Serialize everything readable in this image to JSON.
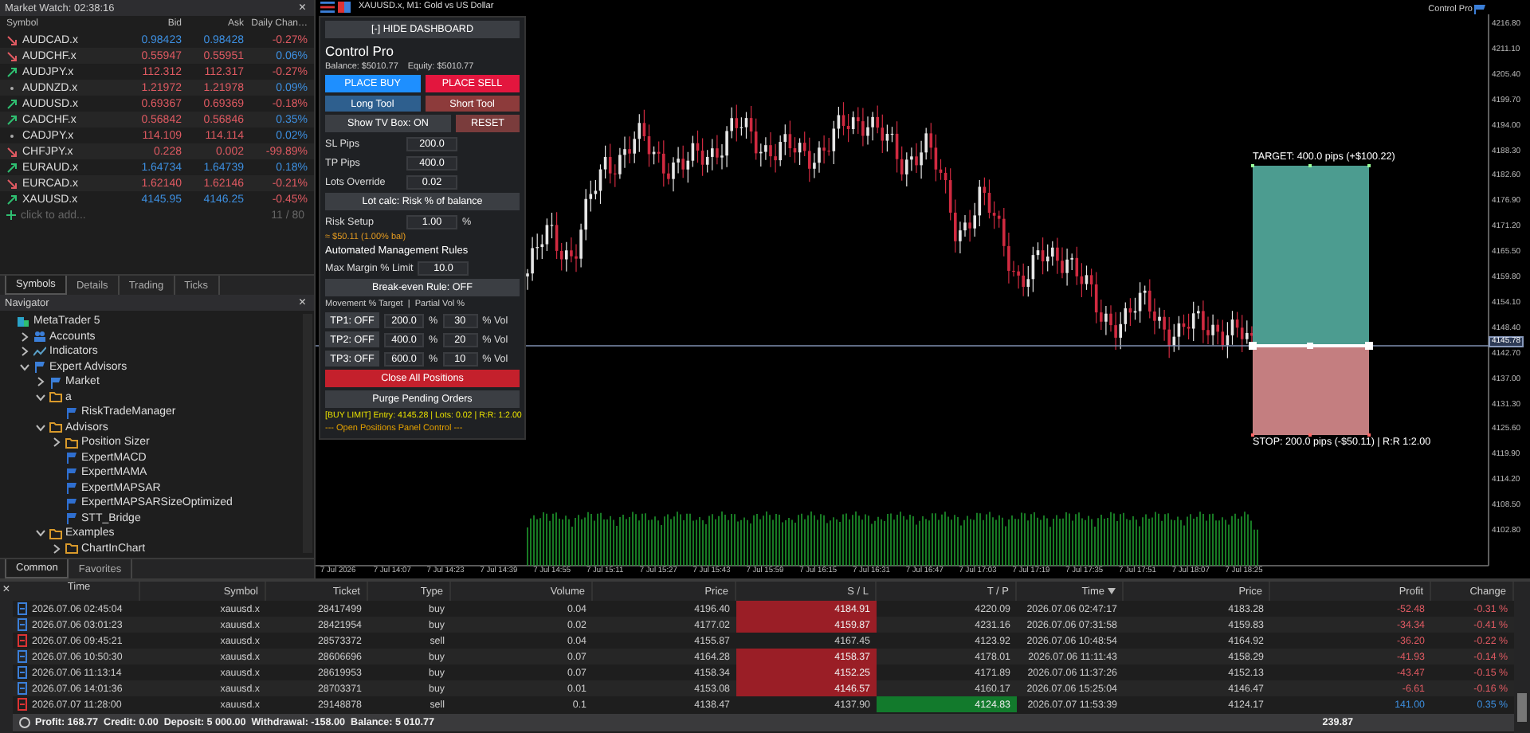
{
  "market_watch": {
    "title": "Market Watch: 02:38:16",
    "close": "×",
    "columns": [
      "Symbol",
      "Bid",
      "Ask",
      "Daily Chan…"
    ],
    "rows": [
      {
        "kind": "down",
        "symbol": "AUDCAD.x",
        "bid": "0.98423",
        "ask": "0.98428",
        "rising": true,
        "change": "-0.27%",
        "change_up": false
      },
      {
        "kind": "down",
        "symbol": "AUDCHF.x",
        "bid": "0.55947",
        "ask": "0.55951",
        "rising": false,
        "change": "0.06%",
        "change_up": true
      },
      {
        "kind": "up",
        "symbol": "AUDJPY.x",
        "bid": "112.312",
        "ask": "112.317",
        "rising": false,
        "change": "-0.27%",
        "change_up": false
      },
      {
        "kind": "flat",
        "symbol": "AUDNZD.x",
        "bid": "1.21972",
        "ask": "1.21978",
        "rising": false,
        "change": "0.09%",
        "change_up": true
      },
      {
        "kind": "up",
        "symbol": "AUDUSD.x",
        "bid": "0.69367",
        "ask": "0.69369",
        "rising": false,
        "change": "-0.18%",
        "change_up": false
      },
      {
        "kind": "up",
        "symbol": "CADCHF.x",
        "bid": "0.56842",
        "ask": "0.56846",
        "rising": false,
        "change": "0.35%",
        "change_up": true
      },
      {
        "kind": "flat",
        "symbol": "CADJPY.x",
        "bid": "114.109",
        "ask": "114.114",
        "rising": false,
        "change": "0.02%",
        "change_up": true
      },
      {
        "kind": "down",
        "symbol": "CHFJPY.x",
        "bid": "0.228",
        "ask": "0.002",
        "rising": false,
        "change": "-99.89%",
        "change_up": false
      },
      {
        "kind": "up",
        "symbol": "EURAUD.x",
        "bid": "1.64734",
        "ask": "1.64739",
        "rising": true,
        "change": "0.18%",
        "change_up": true
      },
      {
        "kind": "down",
        "symbol": "EURCAD.x",
        "bid": "1.62140",
        "ask": "1.62146",
        "rising": false,
        "change": "-0.21%",
        "change_up": false
      },
      {
        "kind": "up",
        "symbol": "XAUUSD.x",
        "bid": "4145.95",
        "ask": "4146.25",
        "rising": true,
        "change": "-0.45%",
        "change_up": false
      }
    ],
    "add_label": "click to add...",
    "count": "11 / 80",
    "tabs": [
      {
        "label": "Symbols",
        "selected": true
      },
      {
        "label": "Details",
        "selected": false
      },
      {
        "label": "Trading",
        "selected": false
      },
      {
        "label": "Ticks",
        "selected": false
      }
    ]
  },
  "navigator": {
    "title": "Navigator",
    "close": "×",
    "tree": [
      {
        "label": "MetaTrader 5",
        "kind": "root",
        "children": [
          {
            "label": "Accounts",
            "kind": "accounts",
            "expanded": false
          },
          {
            "label": "Indicators",
            "kind": "indicators",
            "expanded": false
          },
          {
            "label": "Expert Advisors",
            "kind": "experts",
            "expanded": true,
            "children": [
              {
                "label": "Market",
                "kind": "experts",
                "expanded": false
              },
              {
                "label": "a",
                "kind": "folder",
                "expanded": true,
                "children": [
                  {
                    "label": "RiskTradeManager",
                    "kind": "expert"
                  }
                ]
              },
              {
                "label": "Advisors",
                "kind": "folder",
                "expanded": true,
                "children": [
                  {
                    "label": "Position Sizer",
                    "kind": "folder",
                    "expanded": false
                  },
                  {
                    "label": "ExpertMACD",
                    "kind": "expert"
                  },
                  {
                    "label": "ExpertMAMA",
                    "kind": "expert"
                  },
                  {
                    "label": "ExpertMAPSAR",
                    "kind": "expert"
                  },
                  {
                    "label": "ExpertMAPSARSizeOptimized",
                    "kind": "expert"
                  },
                  {
                    "label": "STT_Bridge",
                    "kind": "expert"
                  }
                ]
              },
              {
                "label": "Examples",
                "kind": "folder",
                "expanded": true,
                "children": [
                  {
                    "label": "ChartInChart",
                    "kind": "folder",
                    "expanded": false
                  }
                ]
              }
            ]
          }
        ]
      }
    ],
    "tabs": [
      {
        "label": "Common",
        "selected": true
      },
      {
        "label": "Favorites",
        "selected": false
      }
    ]
  },
  "chart": {
    "title": "XAUUSD.x, M1:  Gold vs US Dollar",
    "indicator_label": "Control Pro",
    "price_axis": [
      "4216.80",
      "4211.10",
      "4205.40",
      "4199.70",
      "4194.00",
      "4188.30",
      "4182.60",
      "4176.90",
      "4171.20",
      "4165.50",
      "4159.80",
      "4154.10",
      "4148.40",
      "4142.70",
      "4137.00",
      "4131.30",
      "4125.60",
      "4119.90",
      "4114.20",
      "4108.50",
      "4102.80"
    ],
    "current_price": "4145.78",
    "time_axis": [
      "7 Jul 2026",
      "7 Jul 14:07",
      "7 Jul 14:23",
      "7 Jul 14:39",
      "7 Jul 14:55",
      "7 Jul 15:11",
      "7 Jul 15:27",
      "7 Jul 15:43",
      "7 Jul 15:59",
      "7 Jul 16:15",
      "7 Jul 16:31",
      "7 Jul 16:47",
      "7 Jul 17:03",
      "7 Jul 17:19",
      "7 Jul 17:35",
      "7 Jul 17:51",
      "7 Jul 18:07",
      "7 Jul 18:25"
    ],
    "target_label": "TARGET: 400.0 pips (+$100.22)",
    "stop_label": "STOP: 200.0 pips (-$50.11) | R:R 1:2.00"
  },
  "dashboard": {
    "hide_button": "[-] HIDE DASHBOARD",
    "title": "Control Pro",
    "balance": "Balance: $5010.77",
    "equity": "Equity: $5010.77",
    "buy_button": "PLACE BUY",
    "sell_button": "PLACE SELL",
    "long_tool": "Long Tool",
    "short_tool": "Short Tool",
    "tv_box_button": "Show TV Box: ON",
    "reset_button": "RESET",
    "inputs": [
      {
        "label": "SL Pips",
        "value": "200.0"
      },
      {
        "label": "TP Pips",
        "value": "400.0"
      },
      {
        "label": "Lots Override",
        "value": "0.02"
      }
    ],
    "lot_calc_button": "Lot calc: Risk % of balance",
    "risk": {
      "label": "Risk Setup",
      "value": "1.00",
      "unit": "%"
    },
    "risk_estimate": "≈ $50.11 (1.00% bal)",
    "rules_title": "Automated Management Rules",
    "margin": {
      "label": "Max Margin % Limit",
      "value": "10.0"
    },
    "breakeven_button": "Break-even Rule: OFF",
    "tp_header": "Movement % Target  |  Partial Vol %",
    "tp_rows": [
      {
        "button": "TP1: OFF",
        "target": "200.0",
        "target_unit": "%",
        "volume": "30",
        "volume_unit": "% Vol"
      },
      {
        "button": "TP2: OFF",
        "target": "400.0",
        "target_unit": "%",
        "volume": "20",
        "volume_unit": "% Vol"
      },
      {
        "button": "TP3: OFF",
        "target": "600.0",
        "target_unit": "%",
        "volume": "10",
        "volume_unit": "% Vol"
      }
    ],
    "close_all_button": "Close All Positions",
    "purge_button": "Purge Pending Orders",
    "order_info": "[BUY LIMIT] Entry: 4145.28 | Lots: 0.02 | R:R: 1:2.00",
    "positions_label": "--- Open Positions Panel Control ---"
  },
  "trade": {
    "close": "×",
    "columns": [
      {
        "label": "Time",
        "sorted": false
      },
      {
        "label": "Symbol",
        "sorted": false
      },
      {
        "label": "Ticket",
        "sorted": false
      },
      {
        "label": "Type",
        "sorted": false
      },
      {
        "label": "Volume",
        "sorted": false
      },
      {
        "label": "Price",
        "sorted": false
      },
      {
        "label": "S / L",
        "sorted": false
      },
      {
        "label": "T / P",
        "sorted": false
      },
      {
        "label": "Time",
        "sorted": true
      },
      {
        "label": "Price",
        "sorted": false
      },
      {
        "label": "Profit",
        "sorted": false
      },
      {
        "label": "Change",
        "sorted": false
      }
    ],
    "rows": [
      {
        "color": "#3b7fd9",
        "time": "2026.07.06 02:45:04",
        "symbol": "xauusd.x",
        "ticket": "28417499",
        "type": "buy",
        "volume": "0.04",
        "price": "4196.40",
        "sl": "4184.91",
        "sl_alert": true,
        "tp": "4220.09",
        "tp_alert": false,
        "close_time": "2026.07.06 02:47:17",
        "current_price": "4183.28",
        "profit": "-52.48",
        "change": "-0.31 %",
        "profit_up": false
      },
      {
        "color": "#3b7fd9",
        "time": "2026.07.06 03:01:23",
        "symbol": "xauusd.x",
        "ticket": "28421954",
        "type": "buy",
        "volume": "0.02",
        "price": "4177.02",
        "sl": "4159.87",
        "sl_alert": true,
        "tp": "4231.16",
        "tp_alert": false,
        "close_time": "2026.07.06 07:31:58",
        "current_price": "4159.83",
        "profit": "-34.34",
        "change": "-0.41 %",
        "profit_up": false
      },
      {
        "color": "#dd3333",
        "time": "2026.07.06 09:45:21",
        "symbol": "xauusd.x",
        "ticket": "28573372",
        "type": "sell",
        "volume": "0.04",
        "price": "4155.87",
        "sl": "4167.45",
        "sl_alert": false,
        "tp": "4123.92",
        "tp_alert": false,
        "close_time": "2026.07.06 10:48:54",
        "current_price": "4164.92",
        "profit": "-36.20",
        "change": "-0.22 %",
        "profit_up": false
      },
      {
        "color": "#3b7fd9",
        "time": "2026.07.06 10:50:30",
        "symbol": "xauusd.x",
        "ticket": "28606696",
        "type": "buy",
        "volume": "0.07",
        "price": "4164.28",
        "sl": "4158.37",
        "sl_alert": true,
        "tp": "4178.01",
        "tp_alert": false,
        "close_time": "2026.07.06 11:11:43",
        "current_price": "4158.29",
        "profit": "-41.93",
        "change": "-0.14 %",
        "profit_up": false
      },
      {
        "color": "#3b7fd9",
        "time": "2026.07.06 11:13:14",
        "symbol": "xauusd.x",
        "ticket": "28619953",
        "type": "buy",
        "volume": "0.07",
        "price": "4158.34",
        "sl": "4152.25",
        "sl_alert": true,
        "tp": "4171.89",
        "tp_alert": false,
        "close_time": "2026.07.06 11:37:26",
        "current_price": "4152.13",
        "profit": "-43.47",
        "change": "-0.15 %",
        "profit_up": false
      },
      {
        "color": "#3b7fd9",
        "time": "2026.07.06 14:01:36",
        "symbol": "xauusd.x",
        "ticket": "28703371",
        "type": "buy",
        "volume": "0.01",
        "price": "4153.08",
        "sl": "4146.57",
        "sl_alert": true,
        "tp": "4160.17",
        "tp_alert": false,
        "close_time": "2026.07.06 15:25:04",
        "current_price": "4146.47",
        "profit": "-6.61",
        "change": "-0.16 %",
        "profit_up": false
      },
      {
        "color": "#dd3333",
        "time": "2026.07.07 11:28:00",
        "symbol": "xauusd.x",
        "ticket": "29148878",
        "type": "sell",
        "volume": "0.1",
        "price": "4138.47",
        "sl": "4137.90",
        "sl_alert": false,
        "tp": "4124.83",
        "tp_alert": true,
        "close_time": "2026.07.07 11:53:39",
        "current_price": "4124.17",
        "profit": "141.00",
        "change": "0.35 %",
        "profit_up": true
      }
    ],
    "summary": "Profit: 168.77  Credit: 0.00  Deposit: 5 000.00  Withdrawal: -158.00  Balance: 5 010.77",
    "total": "239.87"
  }
}
